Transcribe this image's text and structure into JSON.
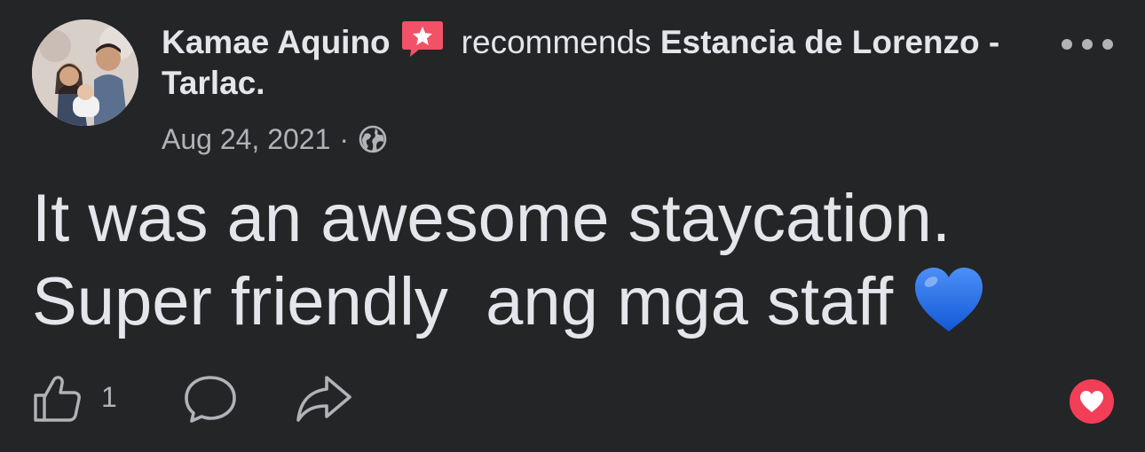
{
  "post": {
    "author": "Kamae Aquino",
    "recommends_text": "recommends",
    "page_name": "Estancia de Lorenzo - Tarlac.",
    "date": "Aug 24, 2021",
    "separator": "·",
    "audience_icon": "globe-icon",
    "badge_icon": "recommendation-star-icon",
    "body_line1": "It was an awesome staycation.",
    "body_line2": "Super friendly  ang mga staff ",
    "body_emoji": "blue-heart-emoji"
  },
  "actions": {
    "like_count": "1",
    "like_icon": "thumbs-up-icon",
    "comment_icon": "comment-icon",
    "share_icon": "share-icon",
    "reaction_icon": "love-reaction-icon"
  },
  "colors": {
    "background": "#242526",
    "text_primary": "#e4e6eb",
    "text_secondary": "#b0b3b8",
    "recommend_badge": "#f25268",
    "love_reaction": "#f33e58",
    "blue_heart": "#1877f2"
  }
}
